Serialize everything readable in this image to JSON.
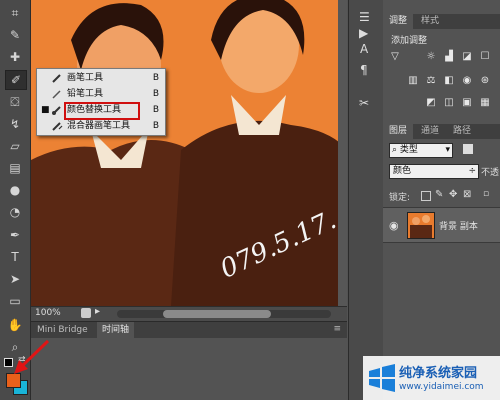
{
  "canvas": {
    "zoom": "100%",
    "handwriting": "079.5.17."
  },
  "bottom_panel": {
    "tabs": [
      "Mini Bridge",
      "时间轴"
    ]
  },
  "tool_flyout": {
    "items": [
      {
        "label": "画笔工具",
        "shortcut": "B",
        "icon": "brush-icon",
        "selected": false
      },
      {
        "label": "铅笔工具",
        "shortcut": "B",
        "icon": "pencil-icon",
        "selected": false
      },
      {
        "label": "颜色替换工具",
        "shortcut": "B",
        "icon": "color-replacement-icon",
        "selected": true
      },
      {
        "label": "混合器画笔工具",
        "shortcut": "B",
        "icon": "mixer-brush-icon",
        "selected": false
      }
    ]
  },
  "colors": {
    "foreground": "#e8601a",
    "background": "#19b4d8",
    "highlight_box": "#d01010",
    "arrow": "#e01515"
  },
  "adjustments_panel": {
    "tabs": [
      "调整",
      "样式"
    ],
    "title": "添加调整"
  },
  "layers_panel": {
    "tabs": [
      "图层",
      "通道",
      "路径"
    ],
    "filter_label": "类型",
    "blend_mode": "颜色",
    "opacity_label": "不透",
    "lock_label": "锁定:",
    "layer_name": "背景 副本"
  },
  "watermark": {
    "brand": "纯净系统家园",
    "url": "www.yidaimei.com"
  }
}
